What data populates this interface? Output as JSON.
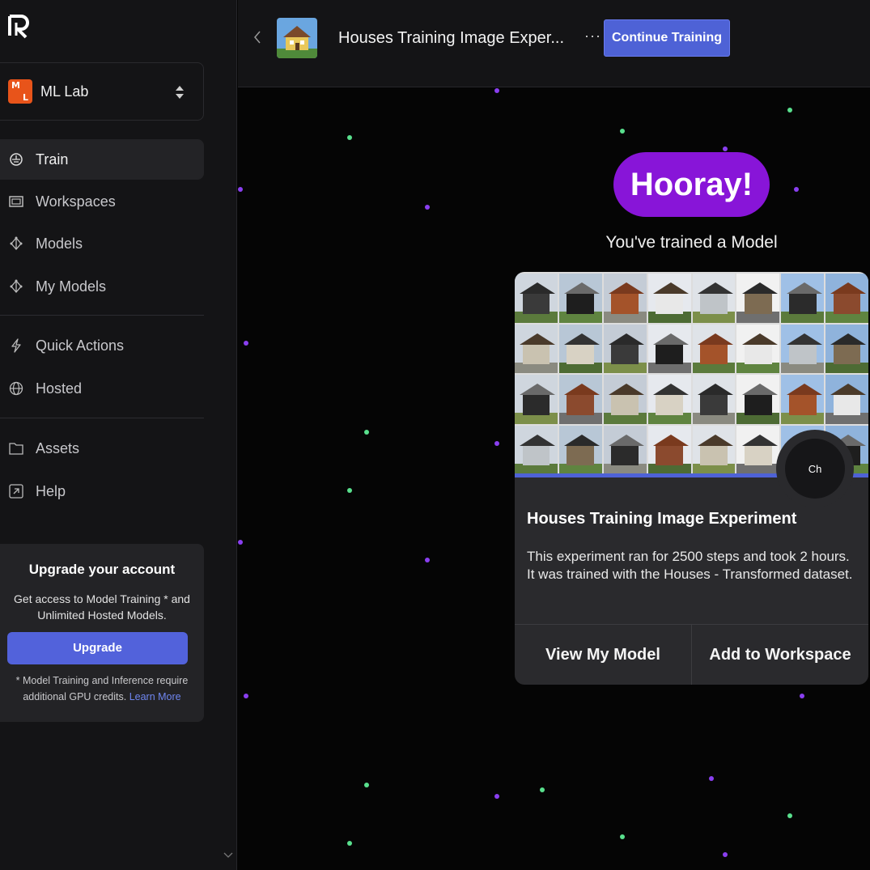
{
  "org": {
    "name": "ML Lab",
    "avatar_top": "M",
    "avatar_bottom": "L"
  },
  "nav": {
    "train": "Train",
    "workspaces": "Workspaces",
    "models": "Models",
    "my_models": "My Models",
    "quick_actions": "Quick Actions",
    "hosted": "Hosted",
    "assets": "Assets",
    "help": "Help"
  },
  "upgrade": {
    "title": "Upgrade your account",
    "description": "Get access to Model Training * and Unlimited Hosted Models.",
    "button": "Upgrade",
    "note": "* Model Training and Inference require additional GPU credits.",
    "link": "Learn More"
  },
  "header": {
    "title": "Houses Training Image Exper...",
    "more": "···",
    "continue": "Continue Training"
  },
  "main": {
    "hooray": "Hooray!",
    "subtitle": "You've trained a Model"
  },
  "card": {
    "badge": "Ch",
    "title": "Houses Training Image Experiment",
    "body": "This experiment ran for 2500 steps and took 2 hours. It was trained with the Houses - Transformed dataset.",
    "view_button": "View My Model",
    "add_button": "Add to Workspace"
  },
  "colors": {
    "accent": "#4e62d6",
    "hooray": "#8815d8",
    "confetti_purple": "#8a3ff0",
    "confetti_green": "#59e08d"
  }
}
